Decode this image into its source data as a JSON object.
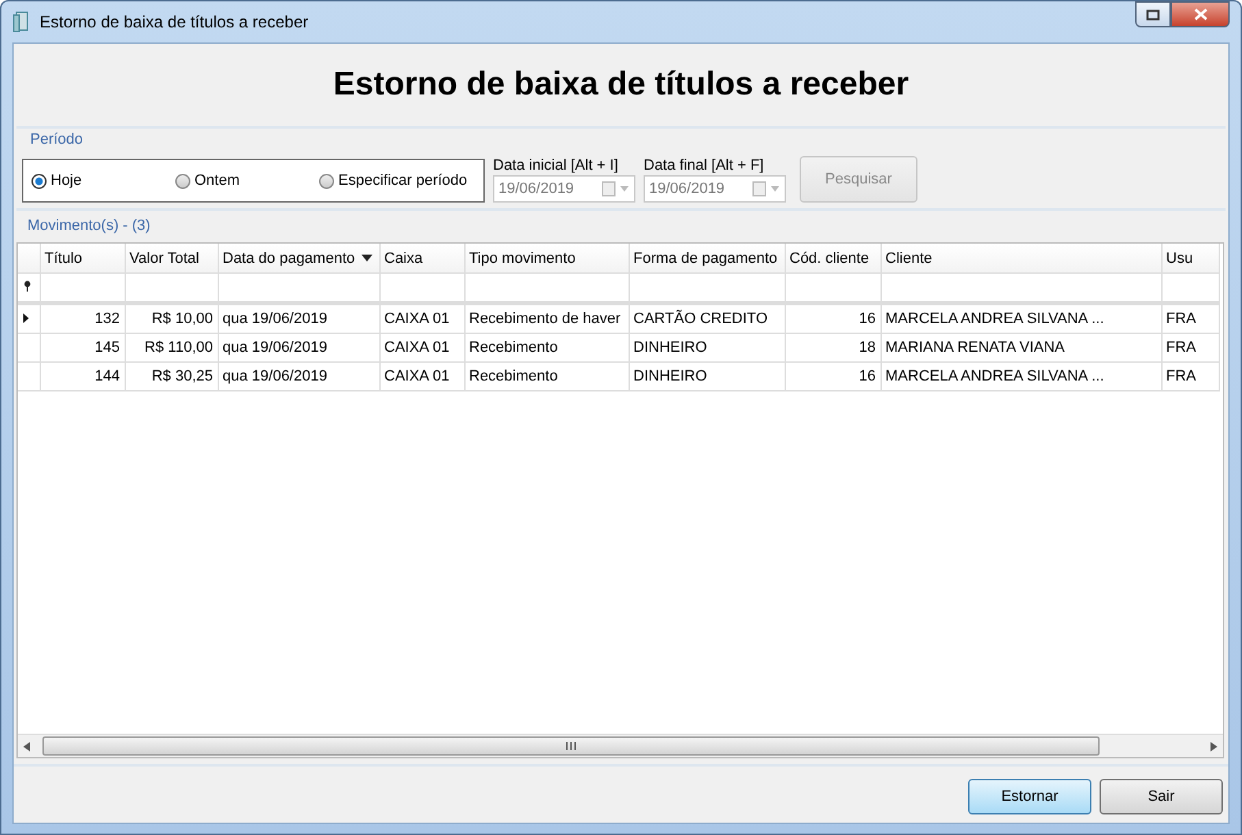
{
  "window": {
    "title": "Estorno de baixa de títulos a receber"
  },
  "header": {
    "title": "Estorno de baixa de títulos a receber"
  },
  "period": {
    "label": "Período",
    "options": [
      {
        "label": "Hoje",
        "selected": true
      },
      {
        "label": "Ontem",
        "selected": false
      },
      {
        "label": "Especificar período",
        "selected": false
      }
    ],
    "start_date": {
      "label": "Data inicial [Alt + I]",
      "value": "19/06/2019",
      "disabled": true
    },
    "end_date": {
      "label": "Data final [Alt + F]",
      "value": "19/06/2019",
      "disabled": true
    },
    "search_button": {
      "label": "Pesquisar",
      "disabled": true
    }
  },
  "movements": {
    "label": "Movimento(s) - (3)",
    "columns": [
      {
        "label": "Título",
        "kind": "number",
        "sorted": false
      },
      {
        "label": "Valor Total",
        "kind": "number",
        "sorted": false
      },
      {
        "label": "Data do pagamento",
        "kind": "text",
        "sorted": true
      },
      {
        "label": "Caixa",
        "kind": "text",
        "sorted": false
      },
      {
        "label": "Tipo movimento",
        "kind": "text",
        "sorted": false
      },
      {
        "label": "Forma de pagamento",
        "kind": "text",
        "sorted": false
      },
      {
        "label": "Cód. cliente",
        "kind": "number",
        "sorted": false
      },
      {
        "label": "Cliente",
        "kind": "text",
        "sorted": false
      },
      {
        "label": "Usu",
        "kind": "text",
        "sorted": false
      }
    ],
    "rows": [
      {
        "current": true,
        "cells": [
          "132",
          "R$ 10,00",
          "qua 19/06/2019",
          "CAIXA 01",
          "Recebimento de haver",
          "CARTÃO CREDITO",
          "16",
          "MARCELA ANDREA SILVANA ...",
          "FRA"
        ]
      },
      {
        "current": false,
        "cells": [
          "145",
          "R$ 110,00",
          "qua 19/06/2019",
          "CAIXA 01",
          "Recebimento",
          "DINHEIRO",
          "18",
          "MARIANA RENATA VIANA",
          "FRA"
        ]
      },
      {
        "current": false,
        "cells": [
          "144",
          "R$ 30,25",
          "qua 19/06/2019",
          "CAIXA 01",
          "Recebimento",
          "DINHEIRO",
          "16",
          "MARCELA ANDREA SILVANA ...",
          "FRA"
        ]
      }
    ]
  },
  "buttons": [
    {
      "label": "Estornar",
      "focused": true
    },
    {
      "label": "Sair",
      "focused": false
    }
  ]
}
